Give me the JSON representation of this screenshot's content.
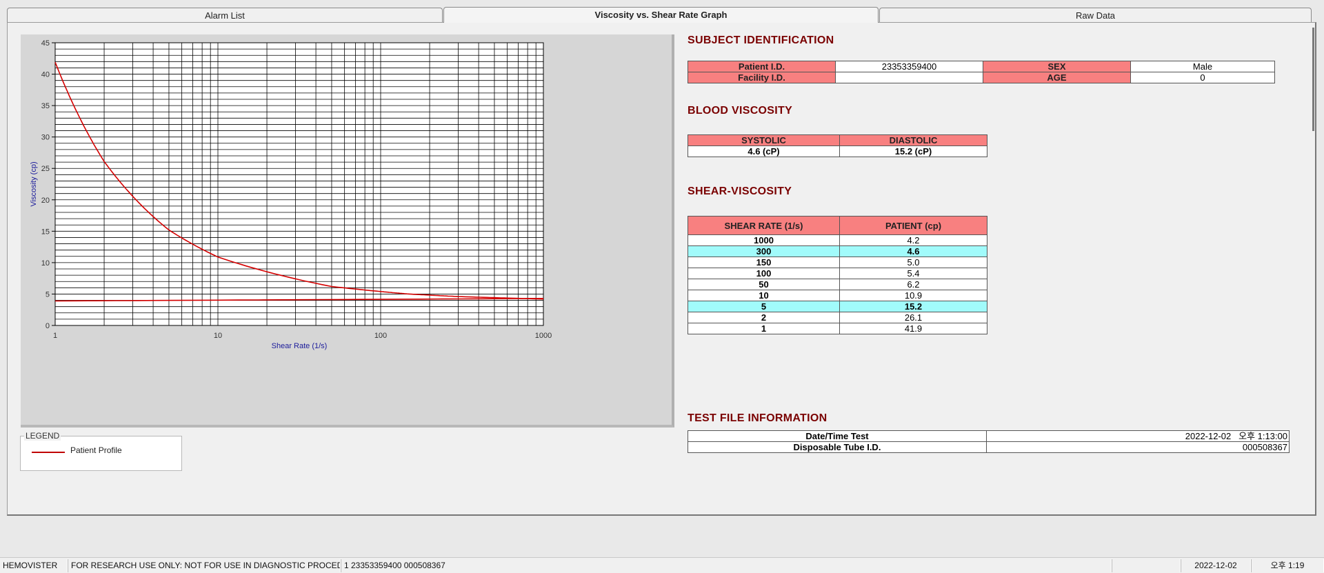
{
  "tabs": [
    {
      "label": "Alarm List"
    },
    {
      "label": "Viscosity vs. Shear Rate Graph"
    },
    {
      "label": "Raw Data"
    }
  ],
  "subject": {
    "title": "SUBJECT IDENTIFICATION",
    "patient_id_label": "Patient I.D.",
    "patient_id": "23353359400",
    "sex_label": "SEX",
    "sex": "Male",
    "facility_label": "Facility I.D.",
    "facility": "",
    "age_label": "AGE",
    "age": "0"
  },
  "blood": {
    "title": "BLOOD VISCOSITY",
    "systolic_label": "SYSTOLIC",
    "diastolic_label": "DIASTOLIC",
    "systolic": "4.6 (cP)",
    "diastolic": "15.2 (cP)"
  },
  "shear": {
    "title": "SHEAR-VISCOSITY",
    "col1": "SHEAR RATE (1/s)",
    "col2": "PATIENT (cp)",
    "rows": [
      {
        "rate": "1000",
        "val": "4.2"
      },
      {
        "rate": "300",
        "val": "4.6"
      },
      {
        "rate": "150",
        "val": "5.0"
      },
      {
        "rate": "100",
        "val": "5.4"
      },
      {
        "rate": "50",
        "val": "6.2"
      },
      {
        "rate": "10",
        "val": "10.9"
      },
      {
        "rate": "5",
        "val": "15.2"
      },
      {
        "rate": "2",
        "val": "26.1"
      },
      {
        "rate": "1",
        "val": "41.9"
      }
    ]
  },
  "testfile": {
    "title": "TEST FILE INFORMATION",
    "datetime_label": "Date/Time Test",
    "datetime": "2022-12-02   오후 1:13:00",
    "tube_label": "Disposable Tube I.D.",
    "tube": "000508367"
  },
  "legend": {
    "title": "LEGEND",
    "series": "Patient Profile"
  },
  "chart_data": {
    "type": "line",
    "xlabel": "Shear Rate (1/s)",
    "ylabel": "Viscosity (cp)",
    "xscale": "log",
    "xlim": [
      1,
      1000
    ],
    "ylim": [
      0,
      45
    ],
    "xticks": [
      "1",
      "10",
      "100",
      "1000"
    ],
    "yticks": [
      "0",
      "5",
      "10",
      "15",
      "20",
      "25",
      "30",
      "35",
      "40",
      "45"
    ],
    "grid": true,
    "series": [
      {
        "name": "Patient Profile",
        "color": "#d40000",
        "x": [
          1,
          2,
          5,
          10,
          50,
          100,
          150,
          300,
          1000
        ],
        "y": [
          41.9,
          26.1,
          15.2,
          10.9,
          6.2,
          5.4,
          5.0,
          4.6,
          4.2
        ]
      },
      {
        "name": "",
        "color": "#d40000",
        "x": [
          1,
          1000
        ],
        "y": [
          3.9,
          4.3
        ]
      }
    ]
  },
  "statusbar": {
    "app": "HEMOVISTER",
    "notice": "FOR RESEARCH USE ONLY: NOT FOR USE IN DIAGNOSTIC PROCEDURES",
    "info": "1  23353359400  000508367",
    "date": "2022-12-02",
    "time": "오후 1:19"
  }
}
